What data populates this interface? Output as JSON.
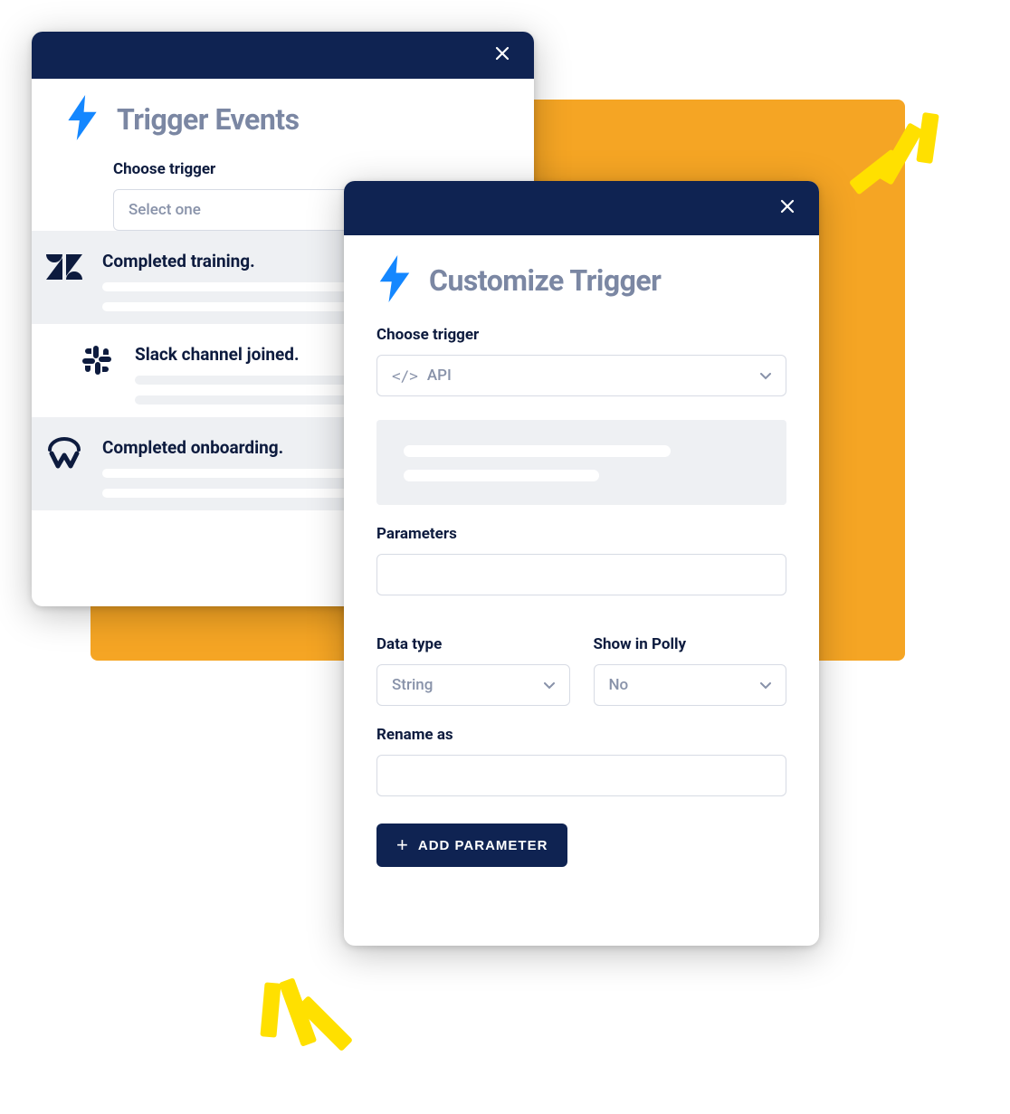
{
  "backPanel": {
    "title": "Trigger Events",
    "chooseLabel": "Choose trigger",
    "selectPlaceholder": "Select one",
    "options": [
      {
        "icon": "zendesk",
        "title": "Completed training."
      },
      {
        "icon": "slack",
        "title": "Slack channel joined."
      },
      {
        "icon": "workday",
        "title": "Completed onboarding."
      }
    ]
  },
  "frontPanel": {
    "title": "Customize Trigger",
    "chooseLabel": "Choose trigger",
    "triggerValue": "API",
    "paramsLabel": "Parameters",
    "dataTypeLabel": "Data type",
    "dataTypeValue": "String",
    "showInPollyLabel": "Show in Polly",
    "showInPollyValue": "No",
    "renameLabel": "Rename as",
    "addParamLabel": "ADD PARAMETER"
  }
}
